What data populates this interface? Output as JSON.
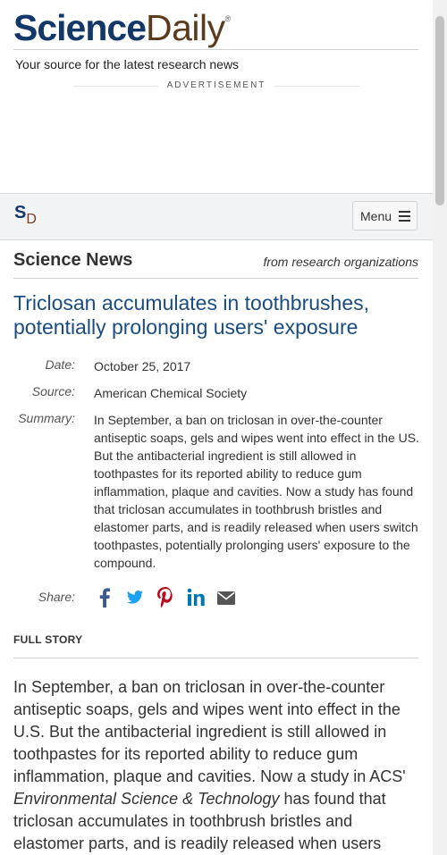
{
  "brand": {
    "name_part1": "Science",
    "name_part2": "Daily",
    "registered": "®",
    "tagline": "Your source for the latest research news"
  },
  "advertisement_label": "ADVERTISEMENT",
  "navbar": {
    "logo_s": "S",
    "logo_d": "D",
    "menu_label": "Menu"
  },
  "section": {
    "title": "Science News",
    "subtitle": "from research organizations"
  },
  "article": {
    "headline": "Triclosan accumulates in toothbrushes, potentially prolonging users' exposure",
    "date_label": "Date:",
    "date": "October 25, 2017",
    "source_label": "Source:",
    "source": "American Chemical Society",
    "summary_label": "Summary:",
    "summary": "In September, a ban on triclosan in over-the-counter antiseptic soaps, gels and wipes went into effect in the US. But the antibacterial ingredient is still allowed in toothpastes for its reported ability to reduce gum inflammation, plaque and cavities. Now a study has found that triclosan accumulates in toothbrush bristles and elastomer parts, and is readily released when users switch toothpastes, potentially prolonging users' exposure to the compound.",
    "share_label": "Share:",
    "share_icons": [
      "facebook-icon",
      "twitter-icon",
      "pinterest-icon",
      "linkedin-icon",
      "email-icon"
    ],
    "full_story_label": "FULL STORY",
    "body_part1": "In September, a ban on triclosan in over-the-counter antiseptic soaps, gels and wipes went into effect in the U.S. But the antibacterial ingredient is still allowed in toothpastes for its reported ability to reduce gum inflammation, plaque and cavities. Now a study in ACS' ",
    "body_journal": "Environmental Science & Technology",
    "body_part2": " has found that triclosan accumulates in toothbrush bristles and elastomer parts, and is readily released when users"
  },
  "colors": {
    "brand_blue": "#12386a",
    "brand_brown": "#5b3b1e",
    "headline_blue": "#1a4c82",
    "facebook": "#3b5998",
    "twitter": "#1da1f2",
    "pinterest": "#bd081c",
    "linkedin": "#0077b5",
    "email": "#555555"
  }
}
